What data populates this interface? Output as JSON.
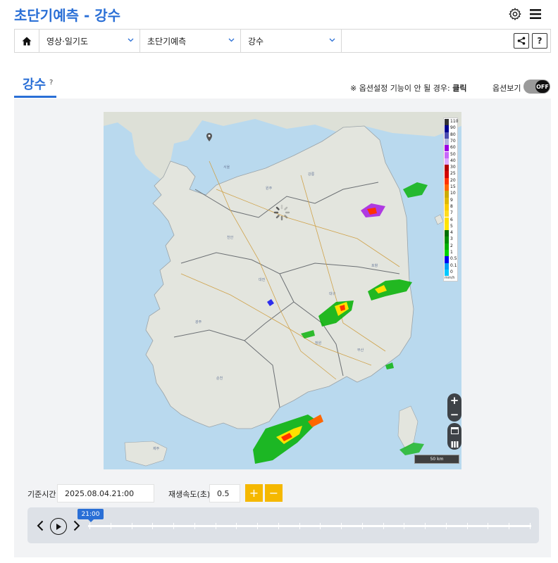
{
  "header": {
    "title": "초단기예측 - 강수"
  },
  "nav": {
    "home_icon": "home-icon",
    "items": [
      {
        "label": "영상·일기도"
      },
      {
        "label": "초단기예측"
      },
      {
        "label": "강수"
      }
    ],
    "share_icon": "share-icon",
    "help_label": "?"
  },
  "section": {
    "title": "강수",
    "help": "?",
    "notice_prefix": "※ 옵션설정 기능이 안 될 경우:",
    "notice_link": "클릭",
    "option_label": "옵션보기",
    "toggle_state": "OFF"
  },
  "legend": {
    "labels": [
      "110",
      "90",
      "80",
      "70",
      "60",
      "50",
      "40",
      "30",
      "25",
      "20",
      "15",
      "10",
      "9",
      "8",
      "7",
      "6",
      "5",
      "4",
      "3",
      "2",
      "1",
      "0.5",
      "0.1",
      "0"
    ],
    "colors": [
      "#333333",
      "#000090",
      "#4c4eb1",
      "#b3b4de",
      "#9d00e3",
      "#c869fa",
      "#e0a9ff",
      "#b40000",
      "#d20000",
      "#ff3200",
      "#ff6600",
      "#ccaa00",
      "#e0b900",
      "#f9cd00",
      "#ffdc1f",
      "#ffe100",
      "#ffe602",
      "#006e00",
      "#008d00",
      "#00b000",
      "#00d400",
      "#0000f0",
      "#009ff5",
      "#00c8ff"
    ],
    "unit": "mm/h"
  },
  "map": {
    "scale_label": "50 km"
  },
  "controls": {
    "base_time_label": "기준시간",
    "base_time_value": "2025.08.04.21:00",
    "speed_label": "재생속도(초)",
    "speed_value": "0.5",
    "plus": "+",
    "minus": "−"
  },
  "timeline": {
    "current": "21:00"
  }
}
